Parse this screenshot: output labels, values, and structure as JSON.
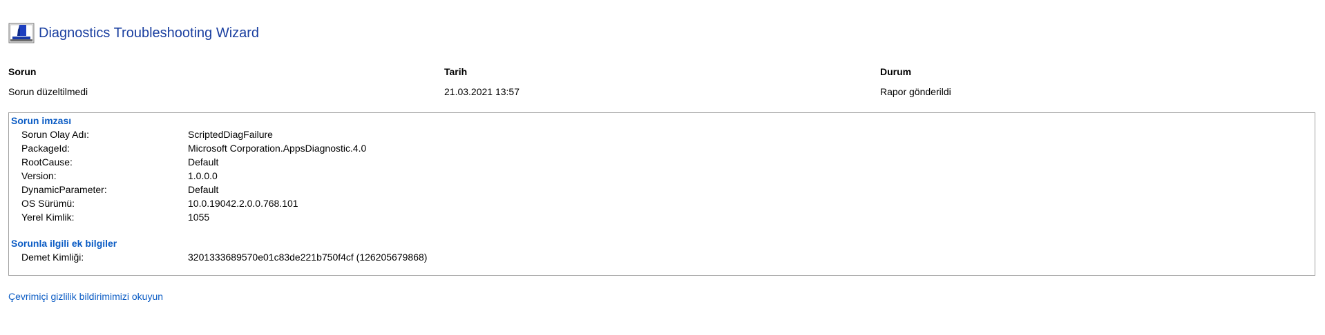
{
  "header": {
    "title": "Diagnostics Troubleshooting Wizard",
    "icon": "diagnostics-wizard-icon"
  },
  "summary": {
    "columns": [
      "Sorun",
      "Tarih",
      "Durum"
    ],
    "values": [
      "Sorun düzeltilmedi",
      "21.03.2021 13:57",
      "Rapor gönderildi"
    ]
  },
  "signature": {
    "title": "Sorun imzası",
    "rows": [
      {
        "key": "Sorun Olay Adı:",
        "value": "ScriptedDiagFailure"
      },
      {
        "key": "PackageId:",
        "value": "Microsoft Corporation.AppsDiagnostic.4.0"
      },
      {
        "key": "RootCause:",
        "value": "Default"
      },
      {
        "key": "Version:",
        "value": "1.0.0.0"
      },
      {
        "key": "DynamicParameter:",
        "value": "Default"
      },
      {
        "key": "OS Sürümü:",
        "value": "10.0.19042.2.0.0.768.101"
      },
      {
        "key": "Yerel Kimlik:",
        "value": "1055"
      }
    ]
  },
  "extra_info": {
    "title": "Sorunla ilgili ek bilgiler",
    "rows": [
      {
        "key": "Demet Kimliği:",
        "value": "3201333689570e01c83de221b750f4cf (126205679868)"
      }
    ]
  },
  "privacy_link": "Çevrimiçi gizlilik bildirimimizi okuyun",
  "colors": {
    "title": "#1a3fa0",
    "link": "#0a5bc4",
    "border": "#a0a0a0"
  }
}
